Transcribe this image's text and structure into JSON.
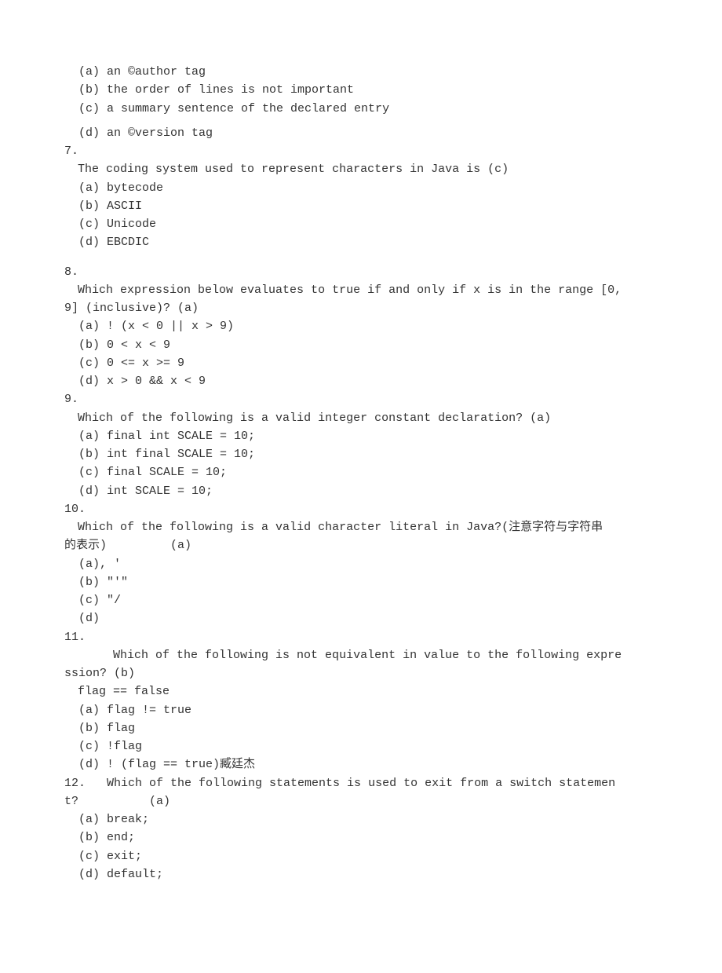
{
  "q6_tail": {
    "a": "(a) an ©author tag",
    "b": "(b) the order of lines is not important",
    "c": "(c) a summary sentence of the declared entry",
    "d": "(d) an ©version tag"
  },
  "q7": {
    "num": "7.",
    "stem": " The coding system used to represent characters in Java is (c)",
    "a": "(a) bytecode",
    "b": "(b) ASCII",
    "c": "(c) Unicode",
    "d": "(d) EBCDIC"
  },
  "q8": {
    "num": "8.",
    "stem1": " Which expression below evaluates to true if and only if x is in the range [0,",
    "stem2": "9] (inclusive)? (a)",
    "a": "(a) ! (x < 0 || x > 9)",
    "b": "(b) 0 < x < 9",
    "c": "(c) 0 <= x >= 9",
    "d": "(d) x > 0 && x < 9"
  },
  "q9": {
    "num": "9.",
    "stem": " Which of the following is a valid integer constant declaration? (a)",
    "a": "(a) final int SCALE = 10;",
    "b": "(b) int final SCALE = 10;",
    "c": "(c) final SCALE = 10;",
    "d": "(d) int SCALE = 10;"
  },
  "q10": {
    "num": "10.",
    "stem1": " Which of the following is a valid character literal in Java?(注意字符与字符串",
    "stem2": "的表示)         (a)",
    "a": "(a), '",
    "b": "(b) \"'\"",
    "c": "(c) \"/",
    "d": "(d)"
  },
  "q11": {
    "num": "11.",
    "stem1": "      Which of the following is not equivalent in value to the following expre",
    "stem2": "ssion? (b)",
    "code": " flag == false",
    "a": "(a) flag != true",
    "b": "(b) flag",
    "c": "(c) !flag",
    "d": "(d) ! (flag == true)臧廷杰"
  },
  "q12": {
    "num": "12.   Which of the following statements is used to exit from a switch statemen",
    "stem2": "t?          (a)",
    "a": "(a) break;",
    "b": "(b) end;",
    "c": "(c) exit;",
    "d": "(d) default;"
  }
}
